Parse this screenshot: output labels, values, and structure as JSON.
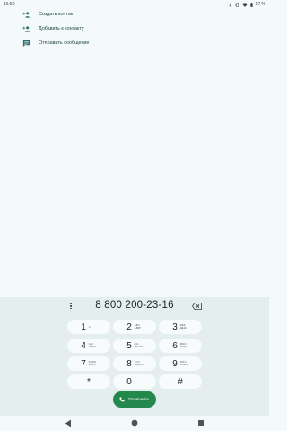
{
  "status_bar": {
    "time": "16:50",
    "battery": "97 %",
    "icons": [
      "bluetooth-icon",
      "vibrate-icon",
      "wifi-icon",
      "battery-icon"
    ]
  },
  "menu": {
    "items": [
      {
        "label": "Создать контакт",
        "icon": "add-person-icon"
      },
      {
        "label": "Добавить к контакту",
        "icon": "add-person-icon"
      },
      {
        "label": "Отправить сообщение",
        "icon": "message-icon"
      }
    ]
  },
  "dialer": {
    "number": "8 800 200-23-16",
    "keys": [
      {
        "digit": "1",
        "letters": "∞",
        "letters2": ""
      },
      {
        "digit": "2",
        "letters": "ABC",
        "letters2": "АБВГ"
      },
      {
        "digit": "3",
        "letters": "DEF",
        "letters2": "ДЕЖЗ"
      },
      {
        "digit": "4",
        "letters": "GHI",
        "letters2": "ИЙКЛ"
      },
      {
        "digit": "5",
        "letters": "JKL",
        "letters2": "МНОП"
      },
      {
        "digit": "6",
        "letters": "MNO",
        "letters2": "РСТУ"
      },
      {
        "digit": "7",
        "letters": "PQRS",
        "letters2": "ФХЦЧ"
      },
      {
        "digit": "8",
        "letters": "TUV",
        "letters2": "ШЩЪЫ"
      },
      {
        "digit": "9",
        "letters": "WXYZ",
        "letters2": "ЬЭЮЯ"
      },
      {
        "digit": "*",
        "letters": "",
        "letters2": ""
      },
      {
        "digit": "0",
        "letters": "+",
        "letters2": ""
      },
      {
        "digit": "#",
        "letters": "",
        "letters2": ""
      }
    ],
    "call_label": "Позвонить"
  },
  "colors": {
    "accent": "#23884b",
    "background": "#f4f9f9",
    "keypad_background": "#e4eeee",
    "key": "#f7fbfb"
  }
}
